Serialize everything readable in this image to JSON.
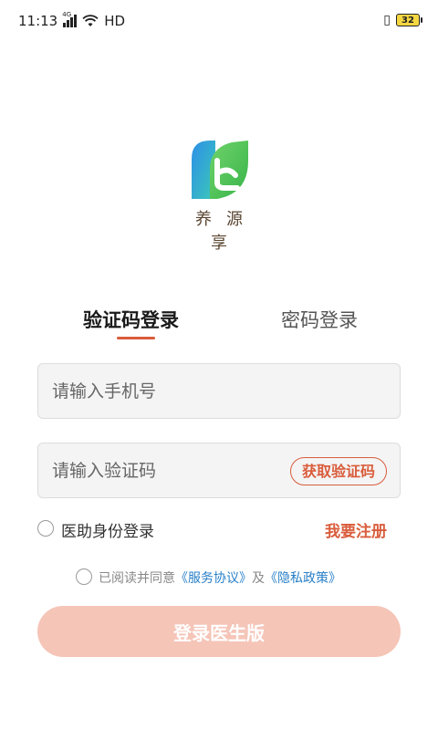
{
  "status_bar": {
    "time": "11:13",
    "network": "HD",
    "signal_sup": "4G",
    "battery": "32"
  },
  "brand": {
    "name": "养源享"
  },
  "tabs": [
    {
      "label": "验证码登录",
      "active": true
    },
    {
      "label": "密码登录",
      "active": false
    }
  ],
  "form": {
    "phone_placeholder": "请输入手机号",
    "code_placeholder": "请输入验证码",
    "get_code_label": "获取验证码"
  },
  "options": {
    "assist_label": "医助身份登录",
    "register_label": "我要注册"
  },
  "agreement": {
    "prefix": "已阅读并同意",
    "service": "《服务协议》",
    "and": "及",
    "privacy": "《隐私政策》"
  },
  "login_button": "登录医生版",
  "colors": {
    "accent": "#d95c3b",
    "link": "#2a80c8",
    "button_disabled": "#f5c5b8"
  }
}
